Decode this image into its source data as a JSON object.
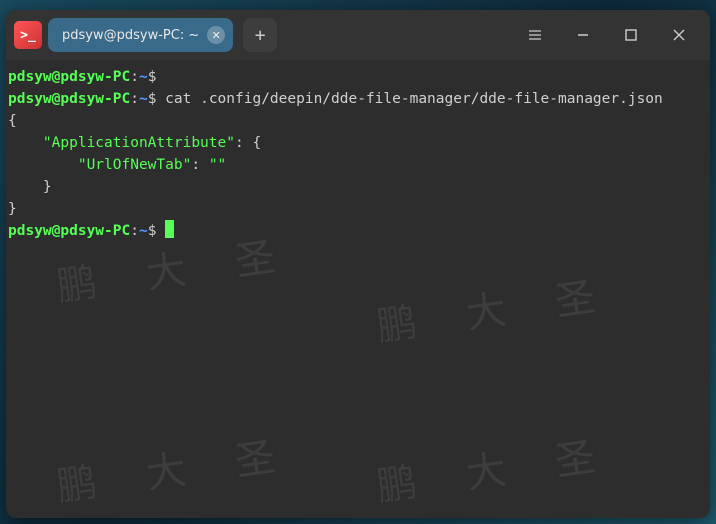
{
  "titlebar": {
    "tab_title": "pdsyw@pdsyw-PC: ~"
  },
  "prompt": {
    "user": "pdsyw",
    "at": "@",
    "host": "pdsyw-PC",
    "colon": ":",
    "path": "~",
    "dollar": "$"
  },
  "lines": {
    "cmd1": "",
    "cmd2": " cat .config/deepin/dde-file-manager/dde-file-manager.json",
    "json1": "{",
    "json2_indent": "    ",
    "json2_key": "\"ApplicationAttribute\"",
    "json2_rest": ": {",
    "json3_indent": "        ",
    "json3_key": "\"UrlOfNewTab\"",
    "json3_mid": ": ",
    "json3_val": "\"\"",
    "json4": "    }",
    "json5": "}"
  },
  "watermark": "鹏 大 圣"
}
